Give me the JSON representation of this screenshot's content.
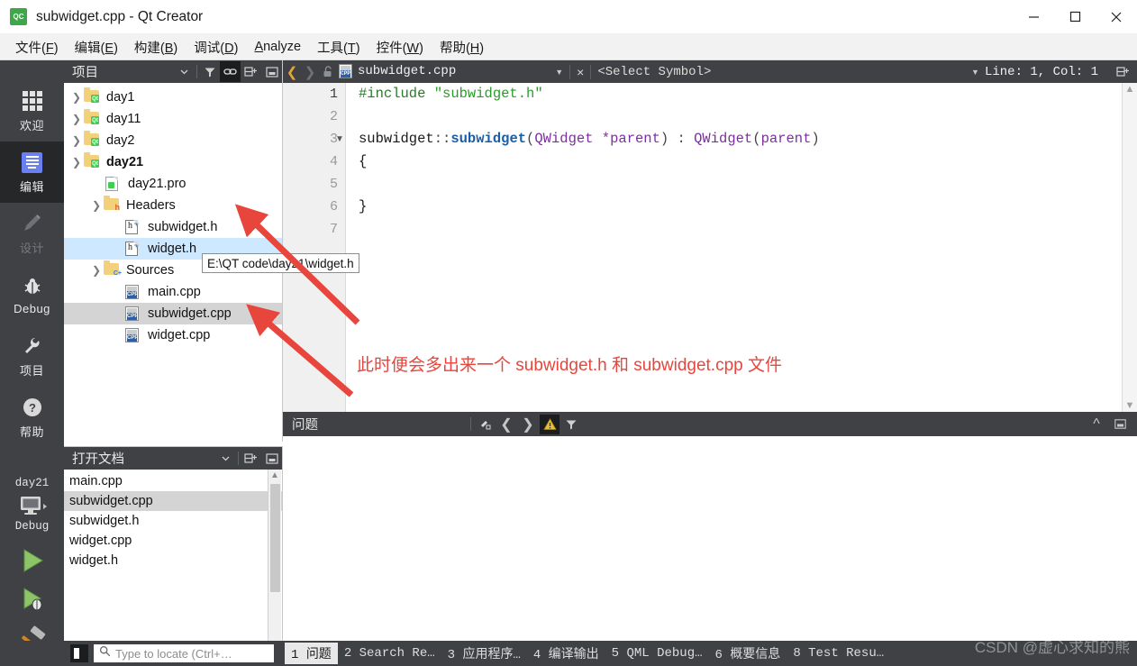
{
  "window": {
    "title": "subwidget.cpp - Qt Creator",
    "logo_text": "QC",
    "minimize_label": "Minimize",
    "maximize_label": "Maximize",
    "close_label": "Close"
  },
  "menubar": [
    {
      "label": "文件(F)",
      "plain": "文件",
      "accel": "F"
    },
    {
      "label": "编辑(E)",
      "plain": "编辑",
      "accel": "E"
    },
    {
      "label": "构建(B)",
      "plain": "构建",
      "accel": "B"
    },
    {
      "label": "调试(D)",
      "plain": "调试",
      "accel": "D"
    },
    {
      "label": "Analyze",
      "plain": "Analyze",
      "accel": "A"
    },
    {
      "label": "工具(T)",
      "plain": "工具",
      "accel": "T"
    },
    {
      "label": "控件(W)",
      "plain": "控件",
      "accel": "W"
    },
    {
      "label": "帮助(H)",
      "plain": "帮助",
      "accel": "H"
    }
  ],
  "modebar": {
    "items": [
      {
        "label": "欢迎",
        "icon": "grid-icon",
        "state": "normal"
      },
      {
        "label": "编辑",
        "icon": "document-lines-icon",
        "state": "active"
      },
      {
        "label": "设计",
        "icon": "pencil-icon",
        "state": "disabled"
      },
      {
        "label": "Debug",
        "icon": "bug-icon",
        "state": "normal"
      },
      {
        "label": "项目",
        "icon": "wrench-icon",
        "state": "normal"
      },
      {
        "label": "帮助",
        "icon": "question-circle-icon",
        "state": "normal"
      }
    ],
    "kit_name": "day21",
    "build_config": "Debug",
    "monitor_icon": "monitor-icon",
    "run_icon": "run-triangle-icon",
    "debug_icon": "run-debug-icon",
    "build_icon": "hammer-icon"
  },
  "project_panel": {
    "title": "项目",
    "tools": [
      {
        "name": "filter-icon",
        "state": "normal"
      },
      {
        "name": "link-sync-icon",
        "state": "active"
      },
      {
        "name": "split-add-icon",
        "state": "normal"
      },
      {
        "name": "collapse-panel-icon",
        "state": "normal"
      }
    ],
    "tree": [
      {
        "label": "day1",
        "indent": 0,
        "twist": "collapsed",
        "icon": "qt-folder-icon",
        "selected": "none",
        "bold": false
      },
      {
        "label": "day11",
        "indent": 0,
        "twist": "collapsed",
        "icon": "qt-folder-icon",
        "selected": "none",
        "bold": false
      },
      {
        "label": "day2",
        "indent": 0,
        "twist": "collapsed",
        "icon": "qt-folder-icon",
        "selected": "none",
        "bold": false
      },
      {
        "label": "day21",
        "indent": 0,
        "twist": "expanded",
        "icon": "qt-folder-icon",
        "selected": "none",
        "bold": true
      },
      {
        "label": "day21.pro",
        "indent": 1,
        "twist": "none",
        "icon": "pro-file-icon",
        "selected": "none",
        "bold": false
      },
      {
        "label": "Headers",
        "indent": 1,
        "twist": "expanded",
        "icon": "headers-folder-icon",
        "selected": "none",
        "bold": false
      },
      {
        "label": "subwidget.h",
        "indent": 2,
        "twist": "none",
        "icon": "header-file-icon",
        "selected": "none",
        "bold": false
      },
      {
        "label": "widget.h",
        "indent": 2,
        "twist": "none",
        "icon": "header-file-icon",
        "selected": "blue",
        "bold": false
      },
      {
        "label": "Sources",
        "indent": 1,
        "twist": "expanded",
        "icon": "sources-folder-icon",
        "selected": "none",
        "bold": false
      },
      {
        "label": "main.cpp",
        "indent": 2,
        "twist": "none",
        "icon": "cpp-file-icon",
        "selected": "none",
        "bold": false
      },
      {
        "label": "subwidget.cpp",
        "indent": 2,
        "twist": "none",
        "icon": "cpp-file-icon",
        "selected": "gray",
        "bold": false
      },
      {
        "label": "widget.cpp",
        "indent": 2,
        "twist": "none",
        "icon": "cpp-file-icon",
        "selected": "none",
        "bold": false
      }
    ]
  },
  "tooltip": {
    "text": "E:\\QT code\\day21\\widget.h"
  },
  "open_documents": {
    "title": "打开文档",
    "tools": [
      {
        "name": "dropdown-icon"
      },
      {
        "name": "split-add-icon"
      },
      {
        "name": "collapse-panel-icon"
      }
    ],
    "items": [
      {
        "label": "main.cpp",
        "selected": false
      },
      {
        "label": "subwidget.cpp",
        "selected": true
      },
      {
        "label": "subwidget.h",
        "selected": false
      },
      {
        "label": "widget.cpp",
        "selected": false
      },
      {
        "label": "widget.h",
        "selected": false
      }
    ]
  },
  "editor_toolbar": {
    "back_icon": "back-arrow-icon",
    "forward_icon": "forward-arrow-icon",
    "lock_icon": "unlocked-icon",
    "file_icon": "cpp-file-icon",
    "file_name": "subwidget.cpp",
    "close_label": "×",
    "symbol_placeholder": "<Select Symbol>",
    "cursor_position": "Line: 1, Col: 1",
    "split_icon": "split-add-icon"
  },
  "editor": {
    "line_numbers": [
      "1",
      "2",
      "3",
      "4",
      "5",
      "6",
      "7"
    ],
    "current_line": 1,
    "fold_marker_line": 3,
    "lines": [
      {
        "n": 1,
        "tokens": [
          {
            "t": "#include ",
            "c": "pre"
          },
          {
            "t": "\"subwidget.h\"",
            "c": "str"
          }
        ]
      },
      {
        "n": 2,
        "tokens": []
      },
      {
        "n": 3,
        "tokens": [
          {
            "t": "subwidget",
            "c": "plain"
          },
          {
            "t": "::",
            "c": "punct"
          },
          {
            "t": "subwidget",
            "c": "fn"
          },
          {
            "t": "(",
            "c": "punct"
          },
          {
            "t": "QWidget",
            "c": "type"
          },
          {
            "t": " *parent",
            "c": "type"
          },
          {
            "t": ")",
            "c": "punct"
          },
          {
            "t": " : ",
            "c": "punct"
          },
          {
            "t": "QWidget",
            "c": "type"
          },
          {
            "t": "(",
            "c": "punct"
          },
          {
            "t": "parent",
            "c": "type"
          },
          {
            "t": ")",
            "c": "punct"
          }
        ]
      },
      {
        "n": 4,
        "tokens": [
          {
            "t": "{",
            "c": "plain"
          }
        ]
      },
      {
        "n": 5,
        "tokens": []
      },
      {
        "n": 6,
        "tokens": [
          {
            "t": "}",
            "c": "plain"
          }
        ]
      },
      {
        "n": 7,
        "tokens": []
      }
    ],
    "annotation": "此时便会多出来一个 subwidget.h 和 subwidget.cpp 文件",
    "annotation_color": "#e8453c"
  },
  "issues_pane": {
    "title": "问题",
    "tools": [
      {
        "name": "clear-broom-icon"
      },
      {
        "name": "prev-issue-icon"
      },
      {
        "name": "next-issue-icon"
      },
      {
        "name": "warning-filter-icon",
        "state": "active"
      },
      {
        "name": "filter-icon"
      }
    ],
    "right_tools": [
      {
        "name": "maximize-pane-icon"
      },
      {
        "name": "close-pane-icon"
      }
    ]
  },
  "statusbar": {
    "toggle_sidebar_icon": "toggle-sidebar-icon",
    "locator_icon": "search-icon",
    "locator_placeholder": "Type to locate (Ctrl+…",
    "panes": [
      {
        "num": "1",
        "label": "问题",
        "active": true
      },
      {
        "num": "2",
        "label": "Search Re…",
        "active": false
      },
      {
        "num": "3",
        "label": "应用程序…",
        "active": false
      },
      {
        "num": "4",
        "label": "编译输出",
        "active": false
      },
      {
        "num": "5",
        "label": "QML Debug…",
        "active": false
      },
      {
        "num": "6",
        "label": "概要信息",
        "active": false
      },
      {
        "num": "8",
        "label": "Test Resu…",
        "active": false
      }
    ]
  },
  "watermark": {
    "text": "CSDN @虚心求知的熊"
  },
  "colors": {
    "dark_chrome": "#3f4145",
    "dark_active": "#262729",
    "accent_blue": "#6a7ff0",
    "selection_blue": "#cde8ff",
    "selection_gray": "#d4d4d4",
    "annotation_red": "#e8453c",
    "qt_green": "#41cd52",
    "run_green": "#81c25a"
  }
}
